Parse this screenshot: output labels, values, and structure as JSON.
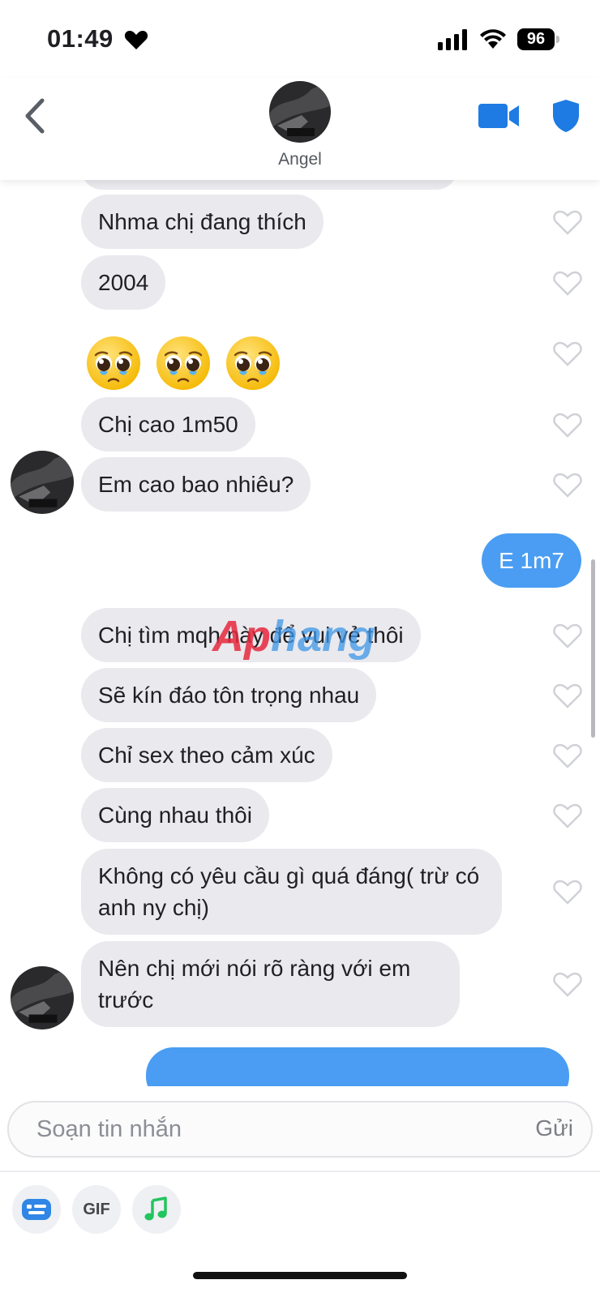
{
  "status_bar": {
    "time": "01:49",
    "battery": "96",
    "icons": [
      "heart-icon",
      "signal-icon",
      "wifi-icon",
      "battery-icon"
    ]
  },
  "header": {
    "contact_name": "Angel",
    "icons": [
      "chevron-left-icon",
      "video-camera-icon",
      "shield-icon"
    ],
    "accent_color": "#1d7be3"
  },
  "messages": {
    "m1": "Nhma chị đang thích",
    "m2": "2004",
    "emoji_count": 3,
    "m4": "Chị cao 1m50",
    "m5": "Em cao bao nhiêu?",
    "m6": "E 1m7",
    "m7": "Chị tìm mqh này để vui vẻ thôi",
    "m8": "Sẽ kín đáo tôn trọng nhau",
    "m9": "Chỉ sex theo cảm xúc",
    "m10": "Cùng nhau thôi",
    "m11": "Không có yêu cầu gì quá đáng( trừ có anh ny chị)",
    "m12": "Nên chị mới nói rõ ràng với em trước"
  },
  "watermark": {
    "part1": "Ap",
    "part2": "hang"
  },
  "composer": {
    "placeholder": "Soạn tin nhắn",
    "send_label": "Gửi",
    "gif_label": "GIF",
    "icons": [
      "sticker-icon",
      "music-note-icon"
    ]
  },
  "colors": {
    "incoming_bubble": "#e9e9ee",
    "outgoing_bubble": "#4a9df2",
    "like_outline": "#cfd1d6"
  }
}
